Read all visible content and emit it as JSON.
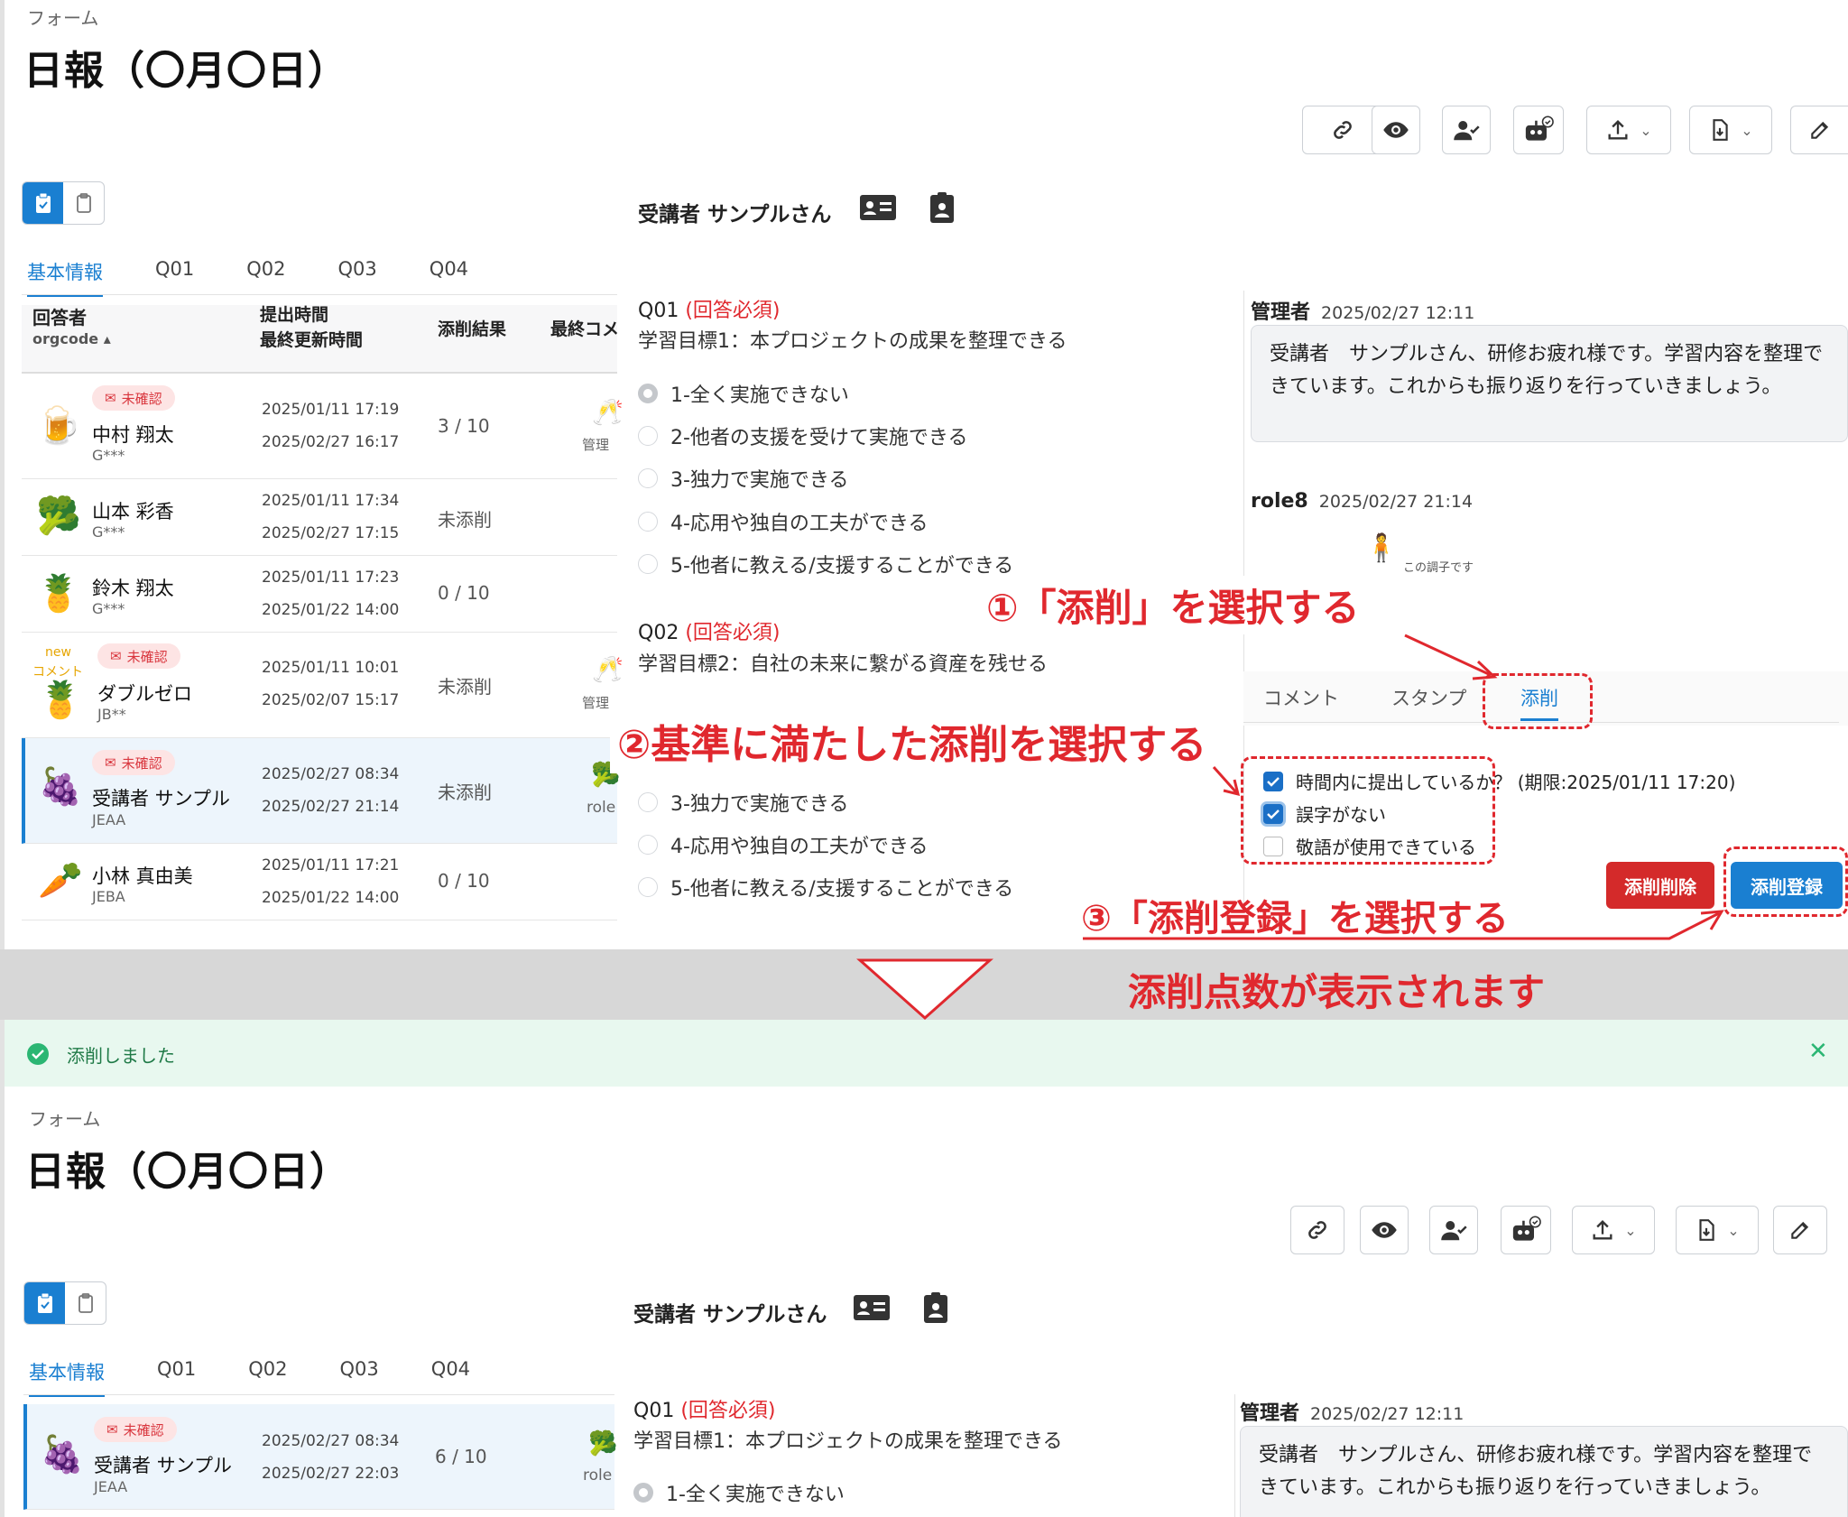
{
  "top": {
    "breadcrumb": "フォーム",
    "title": "日報（〇月〇日）",
    "trainee": "受講者 サンプルさん",
    "tabs": [
      "基本情報",
      "Q01",
      "Q02",
      "Q03",
      "Q04"
    ],
    "columns": {
      "respondent": "回答者",
      "orgcode": "orgcode",
      "time1": "提出時間",
      "time2": "最終更新時間",
      "result": "添削結果",
      "last": "最終コメ"
    },
    "rows": [
      {
        "avatar": "🍺",
        "badge": "未確認",
        "name": "中村 翔太",
        "org": "G***",
        "submitted": "2025/01/11 17:19",
        "updated": "2025/02/27 16:17",
        "result": "3 / 10",
        "last": "管理"
      },
      {
        "avatar": "🥦",
        "badge": "",
        "name": "山本 彩香",
        "org": "G***",
        "submitted": "2025/01/11 17:34",
        "updated": "2025/02/27 17:15",
        "result": "未添削",
        "last": ""
      },
      {
        "avatar": "🍍",
        "badge": "",
        "name": "鈴木 翔太",
        "org": "G***",
        "submitted": "2025/01/11 17:23",
        "updated": "2025/01/22 14:00",
        "result": "0 / 10",
        "last": ""
      },
      {
        "avatar": "🍍",
        "badge": "未確認",
        "new": "new",
        "newc": "コメント",
        "name": "ダブルゼロ",
        "org": "JB**",
        "submitted": "2025/01/11 10:01",
        "updated": "2025/02/07 15:17",
        "result": "未添削",
        "last": "管理"
      },
      {
        "avatar": "🍇",
        "badge": "未確認",
        "name": "受講者 サンプル",
        "org": "JEAA",
        "submitted": "2025/02/27 08:34",
        "updated": "2025/02/27 21:14",
        "result": "未添削",
        "last": "role"
      },
      {
        "avatar": "🥕",
        "badge": "",
        "name": "小林 真由美",
        "org": "JEBA",
        "submitted": "2025/01/11 17:21",
        "updated": "2025/01/22 14:00",
        "result": "0 / 10",
        "last": ""
      }
    ],
    "q01_head": "Q01",
    "required": "(回答必須)",
    "q01_goal": "学習目標1：本プロジェクトの成果を整理できる",
    "options": [
      "1-全く実施できない",
      "2-他者の支援を受けて実施できる",
      "3-独力で実施できる",
      "4-応用や独自の工夫ができる",
      "5-他者に教える/支援することができる"
    ],
    "q02_head": "Q02",
    "q02_goal": "学習目標2：自社の未来に繋がる資産を残せる",
    "comment1_user": "管理者",
    "comment1_time": "2025/02/27 12:11",
    "comment1_text": "受講者　サンプルさん、研修お疲れ様です。学習内容を整理できています。これからも振り返りを行っていきましょう。",
    "comment2_user": "role8",
    "comment2_time": "2025/02/27 21:14",
    "stamp_text": "この調子です",
    "sub_tabs": [
      "コメント",
      "スタンプ",
      "添削"
    ],
    "checks": [
      "時間内に提出しているか？ (期限:2025/01/11 17:20)",
      "誤字がない",
      "敬語が使用できている"
    ],
    "delete_btn": "添削削除",
    "register_btn": "添削登録"
  },
  "annotations": {
    "a1": "①「添削」を選択する",
    "a2": "②基準に満たした添削を選択する",
    "a3": "③「添削登録」を選択する",
    "a4": "添削点数が表示されます"
  },
  "bottom": {
    "toast": "添削しました",
    "row": {
      "avatar": "🍇",
      "badge": "未確認",
      "name": "受講者 サンプル",
      "org": "JEAA",
      "submitted": "2025/02/27 08:34",
      "updated": "2025/02/27 22:03",
      "result": "6 / 10",
      "last": "role"
    }
  },
  "colors": {
    "accent": "#1a7fd1",
    "danger": "#d42a2a",
    "annotation": "#e0282e",
    "success": "#e8f8ef"
  }
}
